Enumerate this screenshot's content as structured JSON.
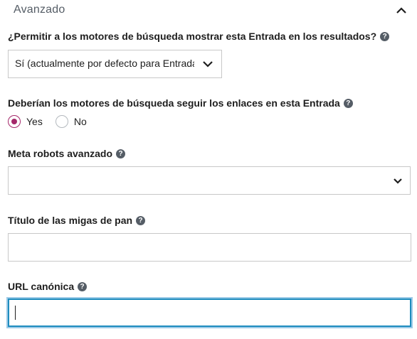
{
  "section": {
    "title": "Avanzado",
    "toggle_icon": "chevron-up-icon"
  },
  "fields": {
    "allow_index": {
      "label": "¿Permitir a los motores de búsqueda mostrar esta Entrada en los resultados?",
      "help_icon": "?",
      "selected": "Sí (actualmente por defecto para Entradas)"
    },
    "follow_links": {
      "label": "Deberían los motores de búsqueda seguir los enlaces en esta Entrada",
      "help_icon": "?",
      "options": [
        {
          "label": "Yes",
          "checked": true
        },
        {
          "label": "No",
          "checked": false
        }
      ]
    },
    "meta_robots": {
      "label": "Meta robots avanzado",
      "help_icon": "?",
      "selected": ""
    },
    "breadcrumbs_title": {
      "label": "Título de las migas de pan",
      "help_icon": "?",
      "value": ""
    },
    "canonical_url": {
      "label": "URL canónica",
      "help_icon": "?",
      "value": ""
    }
  },
  "colors": {
    "accent_radio": "#a4286a",
    "focus_border": "#1e8cbe",
    "input_border": "#c8c8c8"
  }
}
